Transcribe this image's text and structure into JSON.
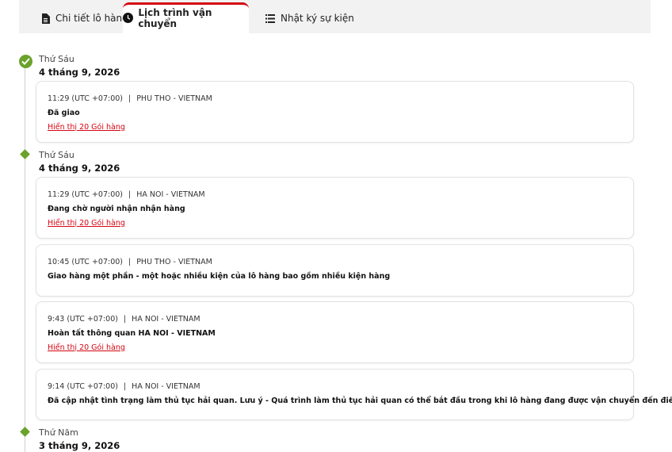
{
  "tabs": [
    {
      "label": "Chi tiết lô hàng",
      "icon": "document-icon"
    },
    {
      "label": "Lịch trình vận chuyển",
      "icon": "clock-icon",
      "active": true
    },
    {
      "label": "Nhật ký sự kiện",
      "icon": "list-icon"
    }
  ],
  "colors": {
    "accent": "#d40511",
    "status_green": "#6aa22c"
  },
  "groups": [
    {
      "day_of_week": "Thứ Sáu",
      "date": "4 tháng 9, 2026",
      "marker": "check-circle-icon",
      "events": [
        {
          "time": "11:29 (UTC +07:00)",
          "separator": "|",
          "location": "PHU THO - VIETNAM",
          "status": "Đã giao",
          "link": "Hiển thị 20 Gói hàng"
        }
      ]
    },
    {
      "day_of_week": "Thứ Sáu",
      "date": "4 tháng 9, 2026",
      "marker": "diamond-icon",
      "events": [
        {
          "time": "11:29 (UTC +07:00)",
          "separator": "|",
          "location": "HA NOI - VIETNAM",
          "status": "Đang chờ người nhận nhận hàng",
          "link": "Hiển thị 20 Gói hàng"
        },
        {
          "time": "10:45 (UTC +07:00)",
          "separator": "|",
          "location": "PHU THO - VIETNAM",
          "status": "Giao hàng một phần - một hoặc nhiều kiện của lô hàng bao gồm nhiều kiện hàng"
        },
        {
          "time": "9:43 (UTC +07:00)",
          "separator": "|",
          "location": "HA NOI - VIETNAM",
          "status": "Hoàn tất thông quan HA NOI - VIETNAM",
          "link": "Hiển thị 20 Gói hàng"
        },
        {
          "time": "9:14 (UTC +07:00)",
          "separator": "|",
          "location": "HA NOI - VIETNAM",
          "status": "Đã cập nhật tình trạng làm thủ tục hải quan. Lưu ý - Quá trình làm thủ tục hải quan có thể bắt đầu trong khi lô hàng đang được vận chuyển đến điểm đến."
        }
      ]
    },
    {
      "day_of_week": "Thứ Năm",
      "date": "3 tháng 9, 2026",
      "marker": "diamond-icon",
      "events": []
    }
  ]
}
